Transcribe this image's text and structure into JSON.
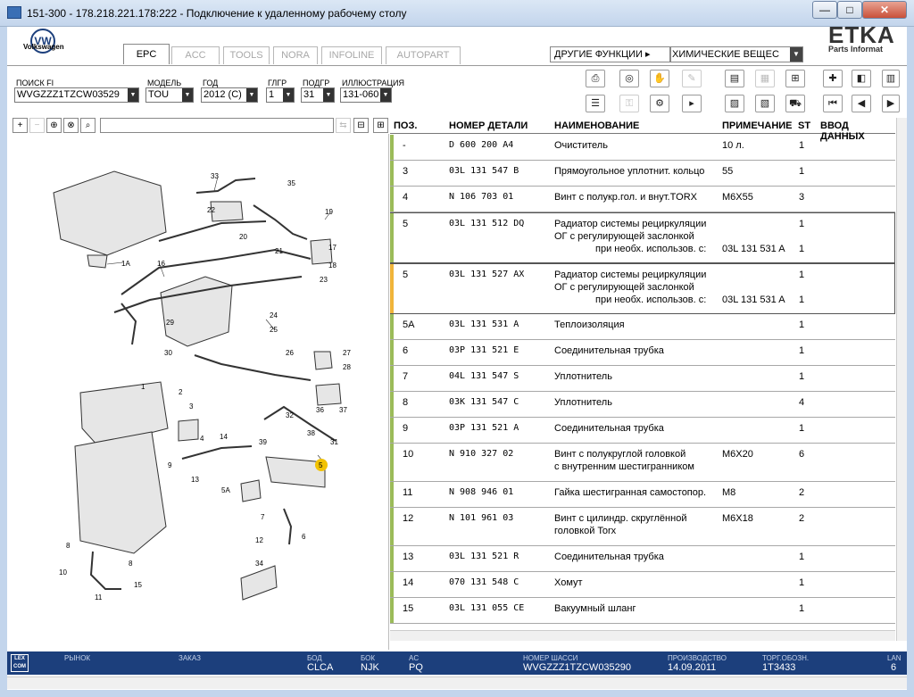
{
  "window": {
    "title": "151-300 - 178.218.221.178:222 - Подключение к удаленному рабочему столу",
    "minimize": "—",
    "maximize": "□",
    "close": "✕"
  },
  "brand": {
    "logo_letters": "VW",
    "logo_text": "Volkswagen",
    "etka": "ETKA",
    "etka_sub": "Parts Informat"
  },
  "tabs": [
    {
      "label": "EPC",
      "active": true
    },
    {
      "label": "ACC",
      "active": false
    },
    {
      "label": "TOOLS",
      "active": false
    },
    {
      "label": "NORA",
      "active": false
    },
    {
      "label": "INFOLINE",
      "active": false
    },
    {
      "label": "AUTOPART",
      "active": false
    }
  ],
  "other_functions": {
    "label": "ДРУГИЕ ФУНКЦИИ",
    "arrow": "▸",
    "value": "ХИМИЧЕСКИЕ ВЕЩЕС"
  },
  "filters": {
    "fi_label": "ПОИСК FI",
    "fi_value": "WVGZZZ1TZCW03529",
    "model_label": "МОДЕЛЬ",
    "model_value": "TOU",
    "year_label": "ГОД",
    "year_value": "2012 (C)",
    "maingroup_label": "ГЛГР",
    "maingroup_value": "1",
    "subgroup_label": "ПОДГР",
    "subgroup_value": "31",
    "illustration_label": "ИЛЛЮСТРАЦИЯ",
    "illustration_value": "131-060"
  },
  "table": {
    "headers": {
      "pos": "ПОЗ.",
      "part_number": "НОМЕР ДЕТАЛИ",
      "name": "НАИМЕНОВАНИЕ",
      "note": "ПРИМЕЧАНИЕ",
      "st": "ST",
      "input": "ВВОД ДАННЫХ"
    },
    "rows": [
      {
        "pos": "-",
        "part": "D   600 200 A4",
        "name": [
          "Очиститель"
        ],
        "note": [
          "10 л."
        ],
        "st": [
          "1"
        ]
      },
      {
        "pos": "3",
        "part": "03L 131 547 B",
        "name": [
          "Прямоугольное уплотнит. кольцо"
        ],
        "note": [
          "55"
        ],
        "st": [
          "1"
        ]
      },
      {
        "pos": "4",
        "part": "N   106 703 01",
        "name": [
          "Винт с полукр.гол. и внут.TORX"
        ],
        "note": [
          "M6X55"
        ],
        "st": [
          "3"
        ]
      },
      {
        "pos": "5",
        "part": "03L 131 512 DQ",
        "name": [
          "Радиатор системы рециркуляции",
          "ОГ с регулирующей заслонкой",
          "при необх. использов. с:"
        ],
        "note": [
          "",
          "",
          "03L 131 531 A"
        ],
        "st": [
          "1",
          "",
          "1"
        ]
      },
      {
        "pos": "5",
        "part": "03L 131 527 AX",
        "name": [
          "Радиатор системы рециркуляции",
          "ОГ с регулирующей заслонкой",
          "при необх. использов. с:"
        ],
        "note": [
          "",
          "",
          "03L 131 531 A"
        ],
        "st": [
          "1",
          "",
          "1"
        ]
      },
      {
        "pos": "5A",
        "part": "03L 131 531 A",
        "name": [
          "Теплоизоляция"
        ],
        "note": [
          ""
        ],
        "st": [
          "1"
        ]
      },
      {
        "pos": "6",
        "part": "03P 131 521 E",
        "name": [
          "Соединительная трубка"
        ],
        "note": [
          ""
        ],
        "st": [
          "1"
        ]
      },
      {
        "pos": "7",
        "part": "04L 131 547 S",
        "name": [
          "Уплотнитель"
        ],
        "note": [
          ""
        ],
        "st": [
          "1"
        ]
      },
      {
        "pos": "8",
        "part": "03K 131 547 C",
        "name": [
          "Уплотнитель"
        ],
        "note": [
          ""
        ],
        "st": [
          "4"
        ]
      },
      {
        "pos": "9",
        "part": "03P 131 521 A",
        "name": [
          "Соединительная трубка"
        ],
        "note": [
          ""
        ],
        "st": [
          "1"
        ]
      },
      {
        "pos": "10",
        "part": "N   910 327 02",
        "name": [
          "Винт с полукруглой головкой",
          "с внутренним шестигранником"
        ],
        "note": [
          "M6X20"
        ],
        "st": [
          "6"
        ]
      },
      {
        "pos": "11",
        "part": "N   908 946 01",
        "name": [
          "Гайка шестигранная самостопор."
        ],
        "note": [
          "M8"
        ],
        "st": [
          "2"
        ]
      },
      {
        "pos": "12",
        "part": "N   101 961 03",
        "name": [
          "Винт с цилиндр. скруглённой",
          "головкой Torx"
        ],
        "note": [
          "M6X18"
        ],
        "st": [
          "2"
        ]
      },
      {
        "pos": "13",
        "part": "03L 131 521 R",
        "name": [
          "Соединительная трубка"
        ],
        "note": [
          ""
        ],
        "st": [
          "1"
        ]
      },
      {
        "pos": "14",
        "part": "070 131 548 C",
        "name": [
          "Хомут"
        ],
        "note": [
          ""
        ],
        "st": [
          "1"
        ]
      },
      {
        "pos": "15",
        "part": "03L 131 055 CE",
        "name": [
          "Вакуумный шланг"
        ],
        "note": [
          ""
        ],
        "st": [
          "1"
        ]
      }
    ]
  },
  "diagram_callouts": [
    "1",
    "1A",
    "2",
    "3",
    "4",
    "5",
    "5A",
    "6",
    "7",
    "8",
    "8",
    "9",
    "10",
    "11",
    "12",
    "13",
    "14",
    "15",
    "16",
    "17",
    "18",
    "19",
    "20",
    "21",
    "22",
    "23",
    "24",
    "25",
    "26",
    "27",
    "28",
    "29",
    "30",
    "31",
    "32",
    "33",
    "34",
    "35",
    "36",
    "37",
    "38",
    "39"
  ],
  "status": {
    "lexcom": "LEX COM",
    "market_label": "РЫНОК",
    "market_value": "",
    "order_label": "ЗАКАЗ",
    "order_value": "",
    "engine_label": "БОД",
    "engine_value": "CLCA",
    "gearbox_label": "БОК",
    "gearbox_value": "NJK",
    "ac_label": "AC",
    "ac_value": "PQ",
    "chassis_label": "НОМЕР ШАССИ",
    "chassis_value": "WVGZZZ1TZCW035290",
    "production_label": "ПРОИЗВОДСТВО",
    "production_value": "14.09.2011",
    "trade_label": "ТОРГ.ОБОЗН.",
    "trade_value": "1T3433",
    "lang_label": "LAN",
    "lang_value": "6"
  },
  "colors": {
    "accent_green": "#9bbb59",
    "accent_orange": "#f0b43a",
    "status_bg": "#1c3f7c"
  }
}
